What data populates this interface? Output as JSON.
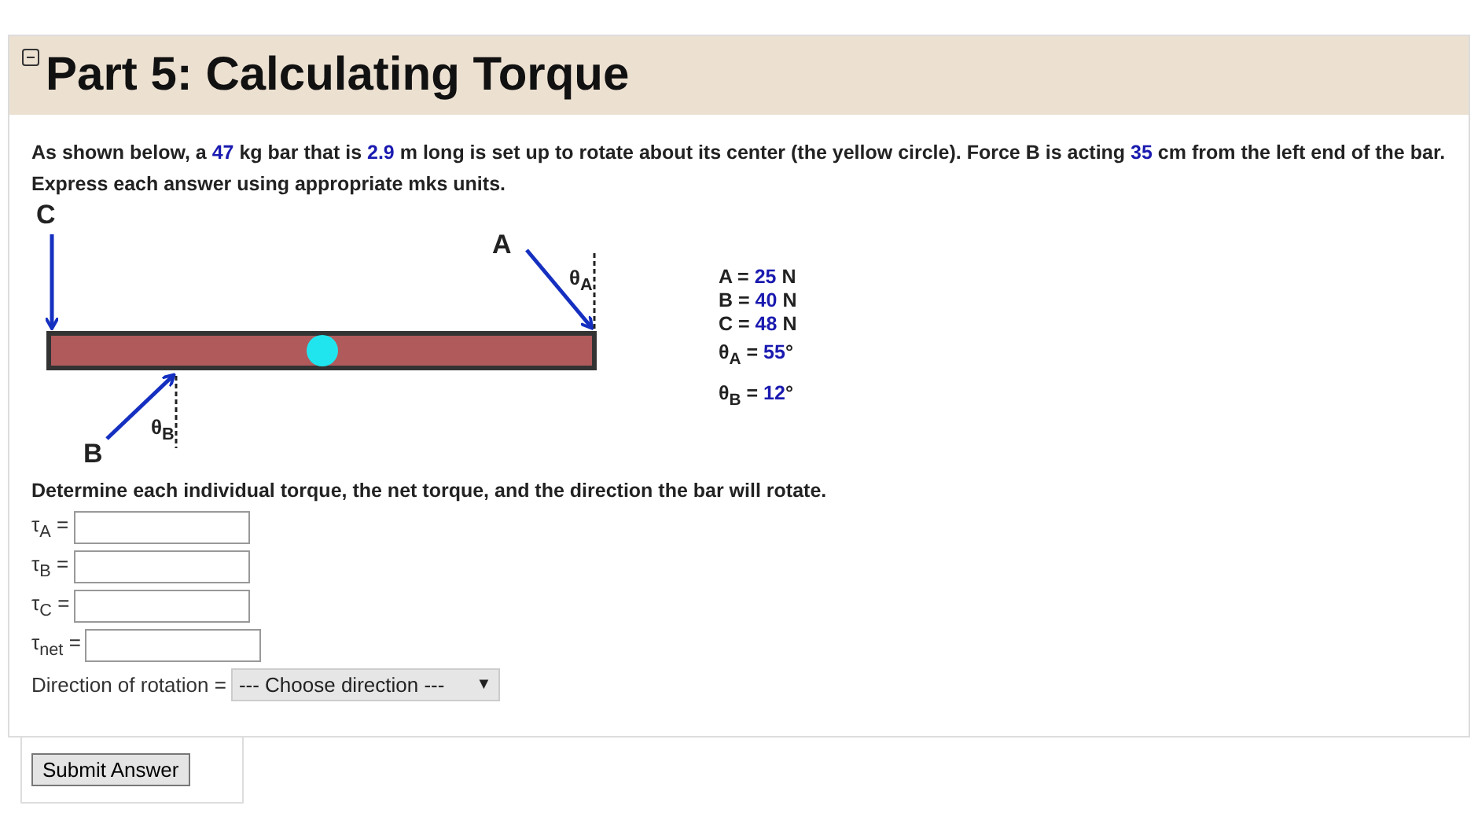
{
  "section": {
    "title": "Part 5: Calculating Torque",
    "collapsed": false
  },
  "intro": [
    {
      "kind": "plain",
      "text": "As shown below, a "
    },
    {
      "kind": "given",
      "text": "47"
    },
    {
      "kind": "plain",
      "text": " kg bar that is "
    },
    {
      "kind": "given",
      "text": "2.9"
    },
    {
      "kind": "plain",
      "text": " m long is set up to rotate about its center (the yellow circle). Force B is acting "
    },
    {
      "kind": "given",
      "text": "35"
    },
    {
      "kind": "plain",
      "text": " cm from the left end of the bar. Express each answer using appropriate mks units."
    }
  ],
  "diagram": {
    "labels": [
      {
        "kind": "force",
        "text": "C"
      },
      {
        "kind": "force",
        "text": "A"
      },
      {
        "kind": "angle",
        "text": "θ$_{A}$"
      },
      {
        "kind": "angle",
        "text": "θ$_{B}$"
      },
      {
        "kind": "force",
        "text": "B"
      }
    ]
  },
  "givens": [
    {
      "label": "A =",
      "value": "25",
      "unit": "N"
    },
    {
      "label": "B =",
      "value": "40",
      "unit": "N"
    },
    {
      "label": "C =",
      "value": "48",
      "unit": "N"
    },
    {
      "label": "θ$_{A}$ =",
      "value": "55",
      "unit": "°"
    },
    {
      "label": "θ$_{B}$ =",
      "value": "12",
      "unit": "°"
    }
  ],
  "question": "Determine each individual torque, the net torque, and the direction the bar will rotate.",
  "answers": [
    {
      "label": "τ$_{A}$ ="
    },
    {
      "label": "τ$_{B}$ ="
    },
    {
      "label": "τ$_{C}$ ="
    },
    {
      "label": "τ$_{net}$ ="
    }
  ],
  "direction": {
    "label": "Direction of rotation =",
    "value": "--- Choose direction ---",
    "caret": "▼"
  },
  "submit": "Submit Answer"
}
